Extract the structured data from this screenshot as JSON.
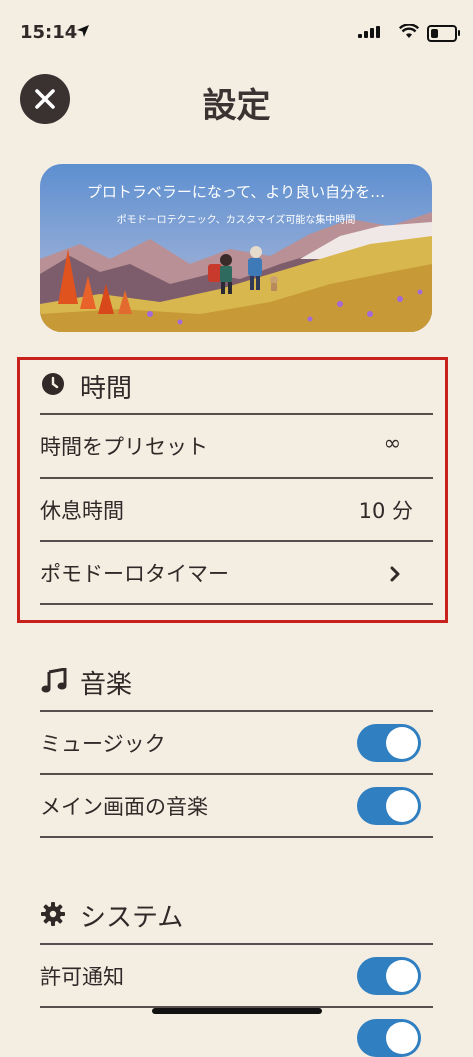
{
  "status": {
    "time": "15:14"
  },
  "header": {
    "title": "設定"
  },
  "banner": {
    "title": "プロトラベラーになって、より良い自分を…",
    "subtitle": "ポモドーロテクニック、カスタマイズ可能な集中時間"
  },
  "sections": {
    "time": {
      "title": "時間",
      "rows": [
        {
          "label": "時間をプリセット",
          "value": "∞"
        },
        {
          "label": "休息時間",
          "value": "10 分"
        },
        {
          "label": "ポモドーロタイマー",
          "value": ""
        }
      ]
    },
    "music": {
      "title": "音楽",
      "rows": [
        {
          "label": "ミュージック",
          "on": true
        },
        {
          "label": "メイン画面の音楽",
          "on": true
        }
      ]
    },
    "system": {
      "title": "システム",
      "rows": [
        {
          "label": "許可通知",
          "on": true
        }
      ]
    }
  },
  "colors": {
    "background": "#f3ede2",
    "toggle_on": "#2f7fc1",
    "highlight": "#c8201d"
  }
}
